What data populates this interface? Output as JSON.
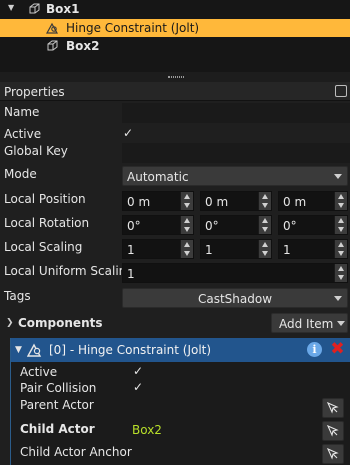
{
  "tree": {
    "items": [
      {
        "label": "Box1",
        "expanded": true
      },
      {
        "label": "Hinge Constraint (Jolt)",
        "selected": true
      },
      {
        "label": "Box2"
      }
    ]
  },
  "properties": {
    "title": "Properties",
    "name_label": "Name",
    "active_label": "Active",
    "active_value": "✓",
    "global_key_label": "Global Key",
    "mode_label": "Mode",
    "mode_value": "Automatic",
    "local_position_label": "Local Position",
    "local_position": [
      "0 m",
      "0 m",
      "0 m"
    ],
    "local_rotation_label": "Local Rotation",
    "local_rotation": [
      "0°",
      "0°",
      "0°"
    ],
    "local_scaling_label": "Local Scaling",
    "local_scaling": [
      "1",
      "1",
      "1"
    ],
    "local_uniform_scaling_label": "Local Uniform Scaling",
    "local_uniform_scaling": "1",
    "tags_label": "Tags",
    "tags_value": "CastShadow"
  },
  "components": {
    "title": "Components",
    "add_item_label": "Add Item",
    "component": {
      "title": "[0] - Hinge Constraint (Jolt)",
      "active_label": "Active",
      "active_value": "✓",
      "pair_collision_label": "Pair Collision",
      "pair_collision_value": "✓",
      "parent_actor_label": "Parent Actor",
      "child_actor_label": "Child Actor",
      "child_actor_value": "Box2",
      "child_actor_anchor_label": "Child Actor Anchor"
    }
  },
  "colors": {
    "selection": "#ffb83a",
    "component_header": "#22558d",
    "link_value": "#b8e02a",
    "delete": "#e02020",
    "info": "#6aa8e8"
  },
  "icons": [
    "expand-arrow-icon",
    "constraint-icon",
    "box-object-icon",
    "panel-options-icon",
    "info-icon",
    "delete-icon",
    "pick-object-icon"
  ]
}
